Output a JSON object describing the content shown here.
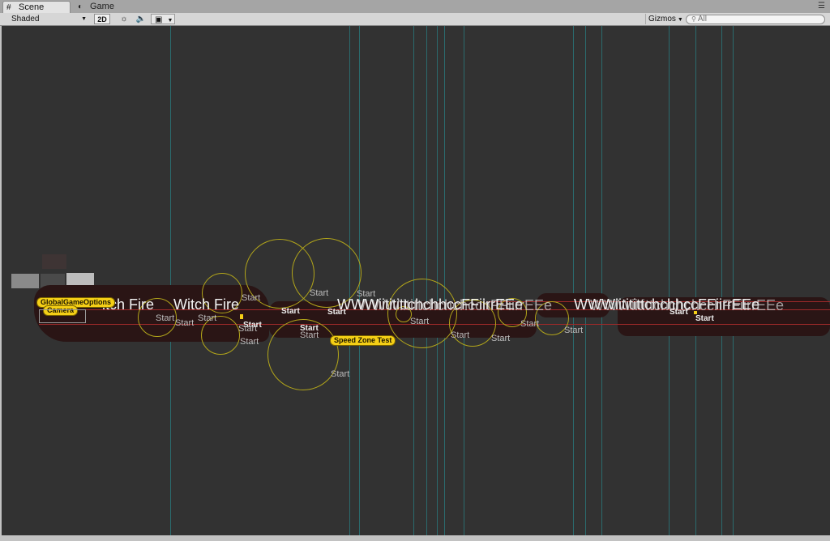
{
  "tabs": [
    {
      "label": "Scene",
      "icon": "grid-icon"
    },
    {
      "label": "Game",
      "icon": "pacman-icon"
    }
  ],
  "toolbar": {
    "shading_mode": "Shaded",
    "mode_2d": "2D",
    "gizmos": "Gizmos",
    "search_placeholder": "All"
  },
  "scene": {
    "badges": {
      "global_options": "GlobalGameOptions",
      "camera": "Camera",
      "speed_zone": "Speed Zone Test"
    },
    "start_label": "Start",
    "witch_fire_left": "itch Fire",
    "witch_fire_right": "Witch Fire",
    "overlap_a": "WWWiititittchchhccFFiirrEEe",
    "overlap_b": "WWWiitittchchchcchFFiirrEEe"
  },
  "colors": {
    "scene_bg": "#323232",
    "guide_line": "#2b6b6e",
    "trigger_ring": "#b3a61a",
    "badge": "#f5cf16",
    "bounds_line": "#9e2a2a"
  }
}
